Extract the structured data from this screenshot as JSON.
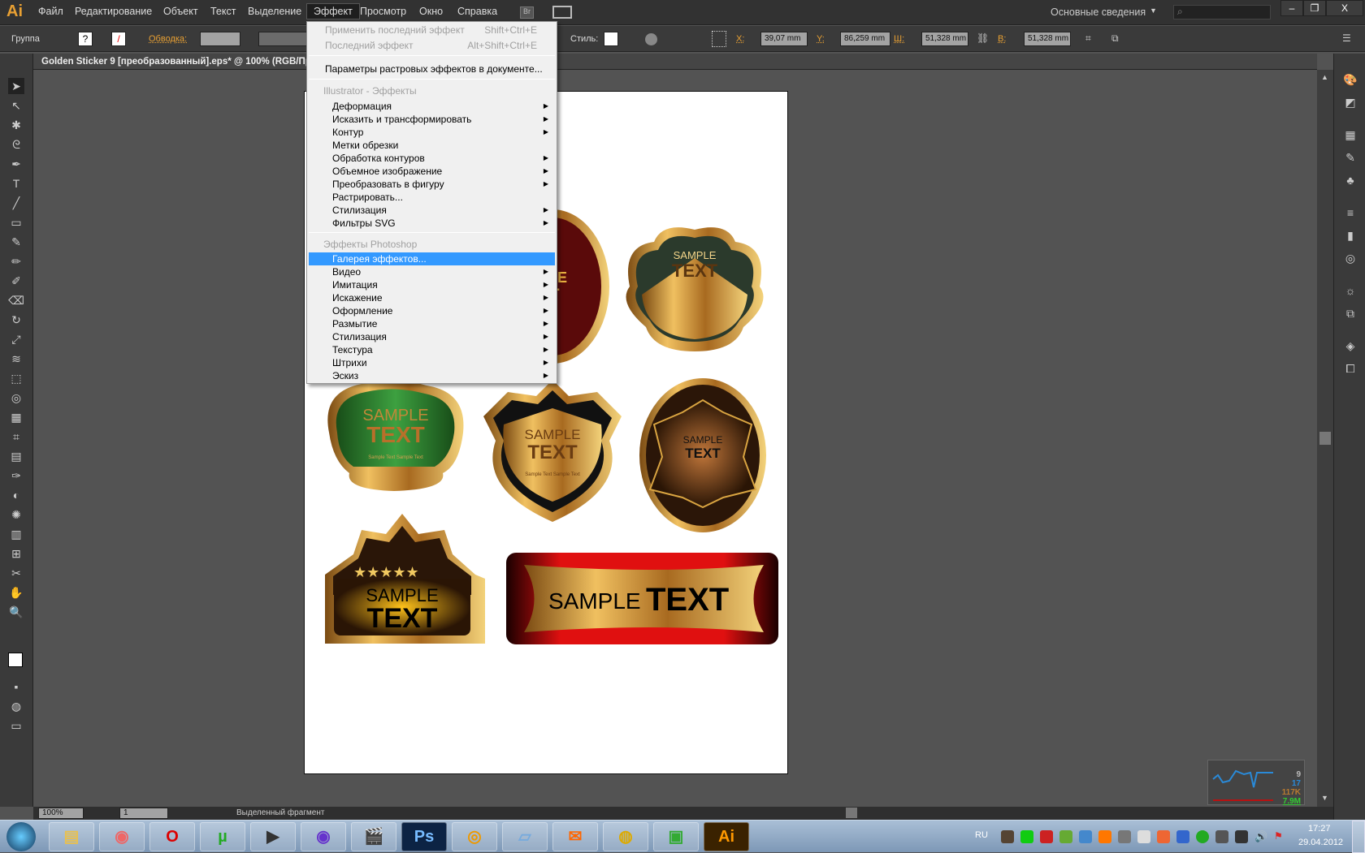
{
  "app": {
    "logo": "Ai",
    "document_title": "Golden Sticker 9 [преобразованный].eps* @ 100% (RGB/Про"
  },
  "menubar": {
    "items": [
      "Файл",
      "Редактирование",
      "Объект",
      "Текст",
      "Выделение",
      "Эффект",
      "Просмотр",
      "Окно",
      "Справка"
    ],
    "active": "Эффект",
    "bridge": "Br",
    "workspace": "Основные сведения",
    "search_placeholder": ""
  },
  "window_controls": {
    "minimize": "–",
    "restore": "❐",
    "close": "X"
  },
  "control_bar": {
    "selection": "Группа",
    "fill": "?",
    "stroke_label": "Обводка:",
    "style_label": "Стиль:",
    "x_label": "X:",
    "x": "39,07 mm",
    "y_label": "Y:",
    "y": "86,259 mm",
    "w_label": "Ш:",
    "w": "51,328 mm",
    "h_label": "В:",
    "h": "51,328 mm"
  },
  "effect_menu": {
    "apply_last": {
      "label": "Применить последний эффект",
      "shortcut": "Shift+Ctrl+E"
    },
    "last": {
      "label": "Последний эффект",
      "shortcut": "Alt+Shift+Ctrl+E"
    },
    "raster_settings": "Параметры растровых эффектов в документе...",
    "illustrator_header": "Illustrator - Эффекты",
    "illustrator_items": [
      {
        "label": "Деформация",
        "submenu": true
      },
      {
        "label": "Исказить и трансформировать",
        "submenu": true
      },
      {
        "label": "Контур",
        "submenu": true
      },
      {
        "label": "Метки обрезки",
        "submenu": false
      },
      {
        "label": "Обработка контуров",
        "submenu": true
      },
      {
        "label": "Объемное изображение",
        "submenu": true
      },
      {
        "label": "Преобразовать в фигуру",
        "submenu": true
      },
      {
        "label": "Растрировать...",
        "submenu": false
      },
      {
        "label": "Стилизация",
        "submenu": true
      },
      {
        "label": "Фильтры SVG",
        "submenu": true
      }
    ],
    "photoshop_header": "Эффекты Photoshop",
    "photoshop_items": [
      {
        "label": "Галерея эффектов...",
        "submenu": false,
        "highlighted": true
      },
      {
        "label": "Видео",
        "submenu": true
      },
      {
        "label": "Имитация",
        "submenu": true
      },
      {
        "label": "Искажение",
        "submenu": true
      },
      {
        "label": "Оформление",
        "submenu": true
      },
      {
        "label": "Размытие",
        "submenu": true
      },
      {
        "label": "Стилизация",
        "submenu": true
      },
      {
        "label": "Текстура",
        "submenu": true
      },
      {
        "label": "Штрихи",
        "submenu": true
      },
      {
        "label": "Эскиз",
        "submenu": true
      }
    ]
  },
  "artwork": {
    "sample": "SAMPLE",
    "text": "TEXT",
    "small": "Sample Text Sample Text",
    "partial_top": "LE",
    "partial_bottom": "T"
  },
  "status_bar": {
    "zoom": "100%",
    "page": "1",
    "status": "Выделенный фрагмент"
  },
  "monitor": {
    "v1": "9",
    "v2": "17",
    "v3": "117K",
    "v4": "7.9M"
  },
  "taskbar": {
    "apps": [
      "explorer",
      "firefox",
      "opera",
      "utorrent",
      "media-player",
      "media-center",
      "video-editor",
      "photoshop",
      "app",
      "notepad",
      "mail",
      "globe",
      "monitor",
      "illustrator"
    ],
    "labels": {
      "photoshop": "Ps",
      "illustrator": "Ai"
    },
    "lang": "RU",
    "time": "17:27",
    "date": "29.04.2012"
  },
  "colors": {
    "accent": "#3399ff",
    "gold": "#d9a441",
    "red": "#e01010",
    "ui_dark": "#323232"
  }
}
